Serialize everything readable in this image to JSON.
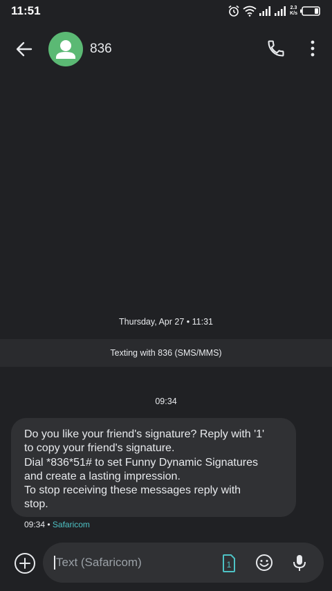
{
  "status_bar": {
    "time": "11:51",
    "net_speed_value": "2.3",
    "net_speed_unit": "K/s",
    "icons": [
      "alarm-icon",
      "wifi-icon",
      "signal-icon",
      "signal-icon",
      "battery-icon"
    ]
  },
  "header": {
    "contact_name": "836",
    "avatar_color": "#5bb974"
  },
  "conversation": {
    "date_separator": "Thursday, Apr 27 • 11:31",
    "texting_banner": "Texting with 836 (SMS/MMS)",
    "message_time": "09:34",
    "message_text": "Do you like your friend's signature? Reply with '1'\nto copy your friend's signature.\nDial *836*51# to set Funny Dynamic Signatures\nand create a lasting impression.\nTo stop receiving these messages reply with\nstop.",
    "meta_time": "09:34",
    "meta_separator": " • ",
    "meta_carrier": "Safaricom",
    "carrier_color": "#4ec3c6"
  },
  "compose": {
    "placeholder": "Text (Safaricom)",
    "sim_number": "1"
  }
}
